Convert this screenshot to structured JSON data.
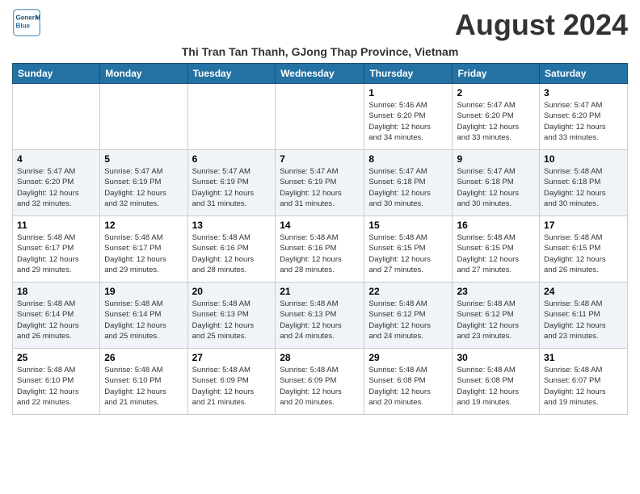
{
  "logo": {
    "line1": "General",
    "line2": "Blue"
  },
  "title": "August 2024",
  "subtitle": "Thi Tran Tan Thanh, GJong Thap Province, Vietnam",
  "days_of_week": [
    "Sunday",
    "Monday",
    "Tuesday",
    "Wednesday",
    "Thursday",
    "Friday",
    "Saturday"
  ],
  "weeks": [
    [
      {
        "day": "",
        "info": ""
      },
      {
        "day": "",
        "info": ""
      },
      {
        "day": "",
        "info": ""
      },
      {
        "day": "",
        "info": ""
      },
      {
        "day": "1",
        "info": "Sunrise: 5:46 AM\nSunset: 6:20 PM\nDaylight: 12 hours\nand 34 minutes."
      },
      {
        "day": "2",
        "info": "Sunrise: 5:47 AM\nSunset: 6:20 PM\nDaylight: 12 hours\nand 33 minutes."
      },
      {
        "day": "3",
        "info": "Sunrise: 5:47 AM\nSunset: 6:20 PM\nDaylight: 12 hours\nand 33 minutes."
      }
    ],
    [
      {
        "day": "4",
        "info": "Sunrise: 5:47 AM\nSunset: 6:20 PM\nDaylight: 12 hours\nand 32 minutes."
      },
      {
        "day": "5",
        "info": "Sunrise: 5:47 AM\nSunset: 6:19 PM\nDaylight: 12 hours\nand 32 minutes."
      },
      {
        "day": "6",
        "info": "Sunrise: 5:47 AM\nSunset: 6:19 PM\nDaylight: 12 hours\nand 31 minutes."
      },
      {
        "day": "7",
        "info": "Sunrise: 5:47 AM\nSunset: 6:19 PM\nDaylight: 12 hours\nand 31 minutes."
      },
      {
        "day": "8",
        "info": "Sunrise: 5:47 AM\nSunset: 6:18 PM\nDaylight: 12 hours\nand 30 minutes."
      },
      {
        "day": "9",
        "info": "Sunrise: 5:47 AM\nSunset: 6:18 PM\nDaylight: 12 hours\nand 30 minutes."
      },
      {
        "day": "10",
        "info": "Sunrise: 5:48 AM\nSunset: 6:18 PM\nDaylight: 12 hours\nand 30 minutes."
      }
    ],
    [
      {
        "day": "11",
        "info": "Sunrise: 5:48 AM\nSunset: 6:17 PM\nDaylight: 12 hours\nand 29 minutes."
      },
      {
        "day": "12",
        "info": "Sunrise: 5:48 AM\nSunset: 6:17 PM\nDaylight: 12 hours\nand 29 minutes."
      },
      {
        "day": "13",
        "info": "Sunrise: 5:48 AM\nSunset: 6:16 PM\nDaylight: 12 hours\nand 28 minutes."
      },
      {
        "day": "14",
        "info": "Sunrise: 5:48 AM\nSunset: 6:16 PM\nDaylight: 12 hours\nand 28 minutes."
      },
      {
        "day": "15",
        "info": "Sunrise: 5:48 AM\nSunset: 6:15 PM\nDaylight: 12 hours\nand 27 minutes."
      },
      {
        "day": "16",
        "info": "Sunrise: 5:48 AM\nSunset: 6:15 PM\nDaylight: 12 hours\nand 27 minutes."
      },
      {
        "day": "17",
        "info": "Sunrise: 5:48 AM\nSunset: 6:15 PM\nDaylight: 12 hours\nand 26 minutes."
      }
    ],
    [
      {
        "day": "18",
        "info": "Sunrise: 5:48 AM\nSunset: 6:14 PM\nDaylight: 12 hours\nand 26 minutes."
      },
      {
        "day": "19",
        "info": "Sunrise: 5:48 AM\nSunset: 6:14 PM\nDaylight: 12 hours\nand 25 minutes."
      },
      {
        "day": "20",
        "info": "Sunrise: 5:48 AM\nSunset: 6:13 PM\nDaylight: 12 hours\nand 25 minutes."
      },
      {
        "day": "21",
        "info": "Sunrise: 5:48 AM\nSunset: 6:13 PM\nDaylight: 12 hours\nand 24 minutes."
      },
      {
        "day": "22",
        "info": "Sunrise: 5:48 AM\nSunset: 6:12 PM\nDaylight: 12 hours\nand 24 minutes."
      },
      {
        "day": "23",
        "info": "Sunrise: 5:48 AM\nSunset: 6:12 PM\nDaylight: 12 hours\nand 23 minutes."
      },
      {
        "day": "24",
        "info": "Sunrise: 5:48 AM\nSunset: 6:11 PM\nDaylight: 12 hours\nand 23 minutes."
      }
    ],
    [
      {
        "day": "25",
        "info": "Sunrise: 5:48 AM\nSunset: 6:10 PM\nDaylight: 12 hours\nand 22 minutes."
      },
      {
        "day": "26",
        "info": "Sunrise: 5:48 AM\nSunset: 6:10 PM\nDaylight: 12 hours\nand 21 minutes."
      },
      {
        "day": "27",
        "info": "Sunrise: 5:48 AM\nSunset: 6:09 PM\nDaylight: 12 hours\nand 21 minutes."
      },
      {
        "day": "28",
        "info": "Sunrise: 5:48 AM\nSunset: 6:09 PM\nDaylight: 12 hours\nand 20 minutes."
      },
      {
        "day": "29",
        "info": "Sunrise: 5:48 AM\nSunset: 6:08 PM\nDaylight: 12 hours\nand 20 minutes."
      },
      {
        "day": "30",
        "info": "Sunrise: 5:48 AM\nSunset: 6:08 PM\nDaylight: 12 hours\nand 19 minutes."
      },
      {
        "day": "31",
        "info": "Sunrise: 5:48 AM\nSunset: 6:07 PM\nDaylight: 12 hours\nand 19 minutes."
      }
    ]
  ]
}
